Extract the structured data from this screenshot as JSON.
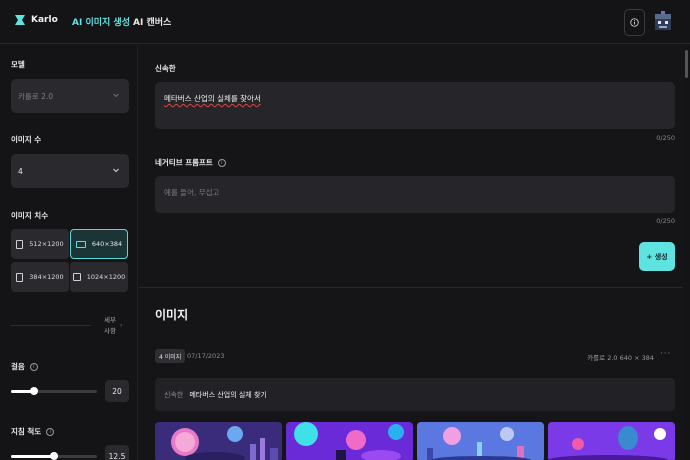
{
  "header": {
    "app_name": "Karlo",
    "nav": [
      {
        "label": "AI 이미지 생성"
      },
      {
        "label": "AI 캔버스"
      }
    ],
    "icons": {
      "logo": "karlo-logo-icon",
      "info": "info-icon",
      "avatar": "avatar"
    },
    "accent_color": "#5fe3e0"
  },
  "sidebar": {
    "model": {
      "label": "모델",
      "value": "카를로 2.0"
    },
    "image_count": {
      "label": "이미지 수",
      "value": "4"
    },
    "image_size": {
      "label": "이미지 치수",
      "options": [
        {
          "label": "512×1200",
          "icon": "portrait-icon",
          "selected": false
        },
        {
          "label": "640×384",
          "icon": "landscape-icon",
          "selected": true
        },
        {
          "label": "384×1200",
          "icon": "portrait-icon",
          "selected": false
        },
        {
          "label": "1024×1200",
          "icon": "square-icon",
          "selected": false
        }
      ]
    },
    "details_label": "세부 사항",
    "steps": {
      "label": "걸음",
      "value": "20",
      "level": 0.27
    },
    "guidance": {
      "label": "지침 척도",
      "value": "12.5",
      "level": 0.5
    }
  },
  "main": {
    "prompt": {
      "label": "신속한",
      "value": "메타버스 산업의 실체를 찾아서",
      "counter": "0/250"
    },
    "negative": {
      "label": "네거티브 프롬프트",
      "placeholder": "예를 들어, 무섭고",
      "counter": "0/250"
    },
    "generate_label": "+ 생성",
    "images": {
      "title": "이미지",
      "badge": "4 이미지",
      "date": "07/17/2023",
      "meta": "카를로 2.0  640 × 384",
      "more": "···",
      "prompt_label": "신속한",
      "prompt_text": "메타버스 산업의 실체 찾기",
      "thumbnails": [
        "thumbnail-1",
        "thumbnail-2",
        "thumbnail-3",
        "thumbnail-4"
      ]
    }
  }
}
